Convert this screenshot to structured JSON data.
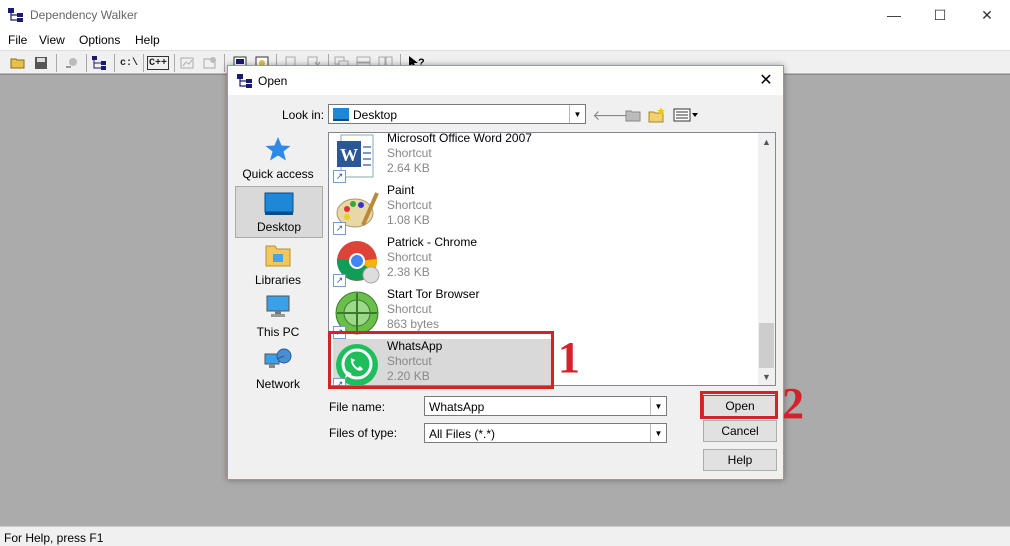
{
  "window": {
    "title": "Dependency Walker",
    "controls": {
      "minimize": "—",
      "maximize": "☐",
      "close": "✕"
    }
  },
  "menu": [
    "File",
    "View",
    "Options",
    "Help"
  ],
  "toolbar": {
    "cdrive_label": "c:\\",
    "cpp_label": "C++"
  },
  "status": {
    "text": "For Help, press F1"
  },
  "dialog": {
    "title": "Open",
    "close": "✕",
    "look_in_label": "Look in:",
    "look_in_value": "Desktop",
    "places": [
      "Quick access",
      "Desktop",
      "Libraries",
      "This PC",
      "Network"
    ],
    "selected_place": "Desktop",
    "files": [
      {
        "name": "Microsoft Office Word 2007",
        "type": "Shortcut",
        "size": "2.64 KB",
        "icon": "word-icon"
      },
      {
        "name": "Paint",
        "type": "Shortcut",
        "size": "1.08 KB",
        "icon": "paint-icon"
      },
      {
        "name": "Patrick - Chrome",
        "type": "Shortcut",
        "size": "2.38 KB",
        "icon": "chrome-icon"
      },
      {
        "name": "Start Tor Browser",
        "type": "Shortcut",
        "size": "863 bytes",
        "icon": "tor-icon"
      },
      {
        "name": "WhatsApp",
        "type": "Shortcut",
        "size": "2.20 KB",
        "icon": "whatsapp-icon"
      }
    ],
    "file_name_label": "File name:",
    "file_name_value": "WhatsApp",
    "files_of_type_label": "Files of type:",
    "files_of_type_value": "All Files (*.*)",
    "buttons": {
      "open": "Open",
      "cancel": "Cancel",
      "help": "Help"
    }
  },
  "annotations": {
    "step1": "1",
    "step2": "2",
    "color": "#d3222a"
  }
}
